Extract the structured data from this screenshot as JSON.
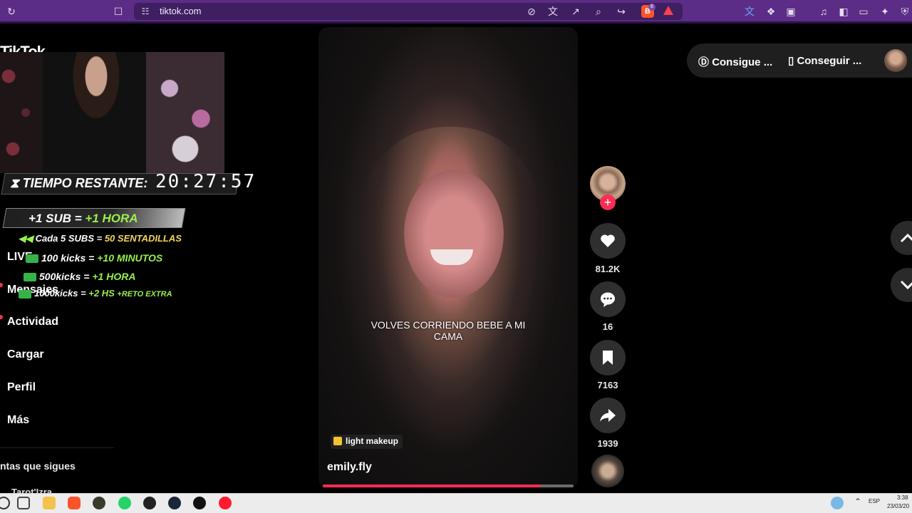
{
  "browser": {
    "url": "tiktok.com",
    "brave_badge": "6",
    "accent": "#5b2d86"
  },
  "sidebar": {
    "logo": "TikTok",
    "items": [
      {
        "label": "LIVE"
      },
      {
        "label": "Mensajes"
      },
      {
        "label": "Actividad"
      },
      {
        "label": "Cargar"
      },
      {
        "label": "Perfil"
      },
      {
        "label": "Más"
      }
    ],
    "following_title": "ntas que sigues",
    "following_item": "Tarot'Izra"
  },
  "stream_overlay": {
    "timer_label": "TIEMPO RESTANTE:",
    "timer_value": "20:27:57",
    "sub_rule_a": "+1 SUB =",
    "sub_rule_b": "+1 HORA",
    "rule1_a": "Cada 5 SUBS =",
    "rule1_b": "50 SENTADILLAS",
    "rule2_a": "100 kicks =",
    "rule2_b": "+10 MINUTOS",
    "rule3_a": "500kicks =",
    "rule3_b": "+1 HORA",
    "rule4_a": "1000kicks =",
    "rule4_b": "+2 HS",
    "rule4_c": "+RETO EXTRA"
  },
  "video": {
    "caption": "VOLVES CORRIENDO BEBE A MI CAMA",
    "tag": "light makeup",
    "author": "emily.fly",
    "progress": 0.87
  },
  "actions": {
    "likes": "81.2K",
    "comments": "16",
    "saves": "7163",
    "shares": "1939"
  },
  "top_actions": {
    "coins": "Consigue ...",
    "app": "Conseguir ..."
  },
  "taskbar": {
    "lang": "ESP",
    "time": "3:38",
    "date": "23/03/20"
  }
}
